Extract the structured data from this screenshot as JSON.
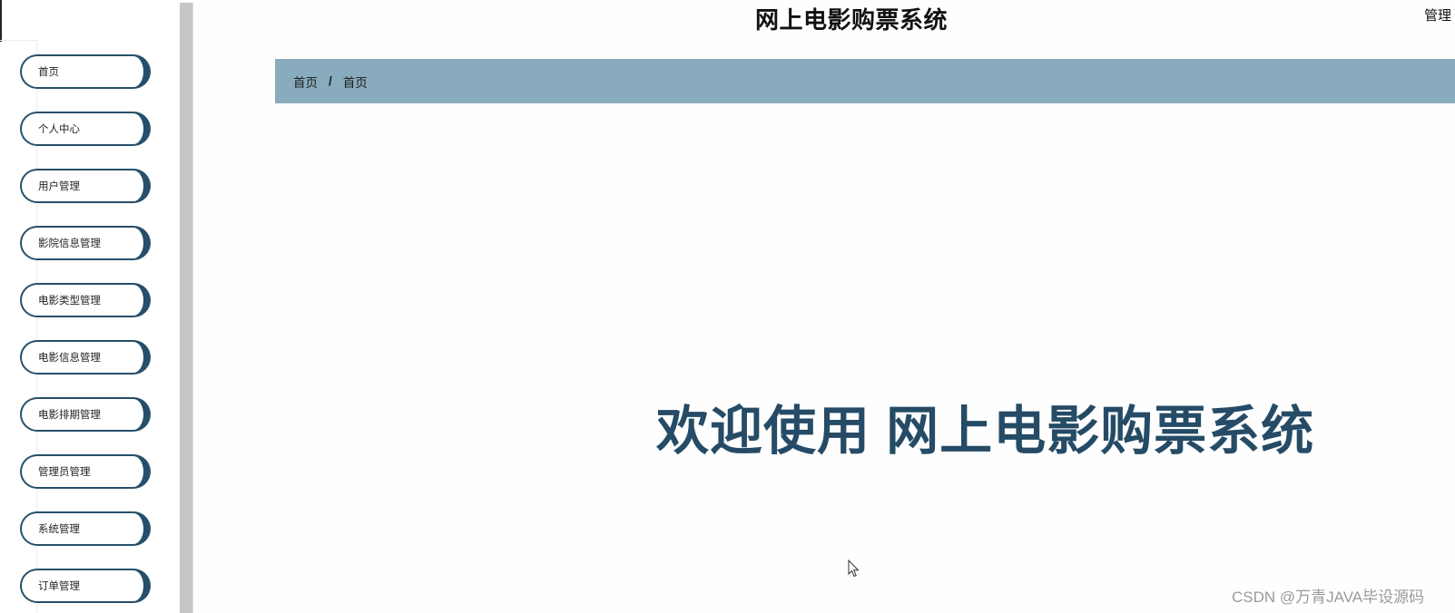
{
  "header": {
    "title": "网上电影购票系统",
    "user_label": "管理"
  },
  "sidebar": {
    "items": [
      {
        "label": "首页"
      },
      {
        "label": "个人中心"
      },
      {
        "label": "用户管理"
      },
      {
        "label": "影院信息管理"
      },
      {
        "label": "电影类型管理"
      },
      {
        "label": "电影信息管理"
      },
      {
        "label": "电影排期管理"
      },
      {
        "label": "管理员管理"
      },
      {
        "label": "系统管理"
      },
      {
        "label": "订单管理"
      }
    ]
  },
  "breadcrumb": {
    "items": [
      "首页",
      "首页"
    ],
    "separator": "/"
  },
  "main": {
    "welcome_text": "欢迎使用 网上电影购票系统"
  },
  "watermark": {
    "text": "CSDN @万青JAVA毕设源码"
  },
  "colors": {
    "accent_dark": "#264f6b",
    "breadcrumb_bg": "#88acbe",
    "welcome_text": "#254b66"
  },
  "icons": {
    "cursor": "mouse-pointer-icon"
  }
}
